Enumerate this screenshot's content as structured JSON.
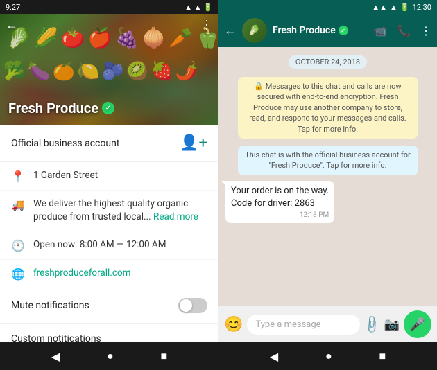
{
  "left": {
    "status_bar": {
      "time": "9:27",
      "icons": "signal wifi battery"
    },
    "hero": {
      "name": "Fresh Produce",
      "verified": "✓",
      "back_icon": "←",
      "dots_icon": "⋮"
    },
    "official_row": {
      "label": "Official business account",
      "icon": "👤+"
    },
    "details": [
      {
        "icon": "📍",
        "text": "1 Garden Street",
        "link": null,
        "read_more": null
      },
      {
        "icon": "🚚",
        "text": "We deliver the highest quality organic produce from trusted local... ",
        "link": null,
        "read_more": "Read more"
      },
      {
        "icon": "🕐",
        "text": "Open now: 8:00 AM — 12:00 AM",
        "link": null,
        "read_more": null
      },
      {
        "icon": "🌐",
        "text": null,
        "link": "freshproduceforall.com",
        "read_more": null
      }
    ],
    "settings": [
      {
        "label": "Mute notifications",
        "has_toggle": true,
        "toggle_on": false
      },
      {
        "label": "Custom notitications",
        "has_toggle": false,
        "toggle_on": false
      }
    ],
    "nav": {
      "back": "◀",
      "home": "●",
      "square": "■"
    }
  },
  "right": {
    "status_bar": {
      "time": "12:30"
    },
    "header": {
      "name": "Fresh Produce",
      "verified": "✓",
      "back_icon": "←",
      "video_icon": "📹",
      "phone_icon": "📞",
      "dots_icon": "⋮"
    },
    "chat": {
      "date_badge": "OCTOBER 24, 2018",
      "system_messages": [
        "🔒 Messages to this chat and calls are now secured with end-to-end encryption. Fresh Produce may use another company to store, read, and respond to your messages and calls. Tap for more info.",
        "This chat is with the official business account for \"Fresh Produce\". Tap for more info."
      ],
      "messages": [
        {
          "text": "Your order is on the way.\nCode for driver: 2863",
          "time": "12:18 PM",
          "direction": "received"
        }
      ]
    },
    "input": {
      "placeholder": "Type a message",
      "emoji_icon": "😊",
      "attach_icon": "📎",
      "camera_icon": "📷",
      "mic_icon": "🎤"
    },
    "nav": {
      "back": "◀",
      "home": "●",
      "square": "■"
    }
  }
}
